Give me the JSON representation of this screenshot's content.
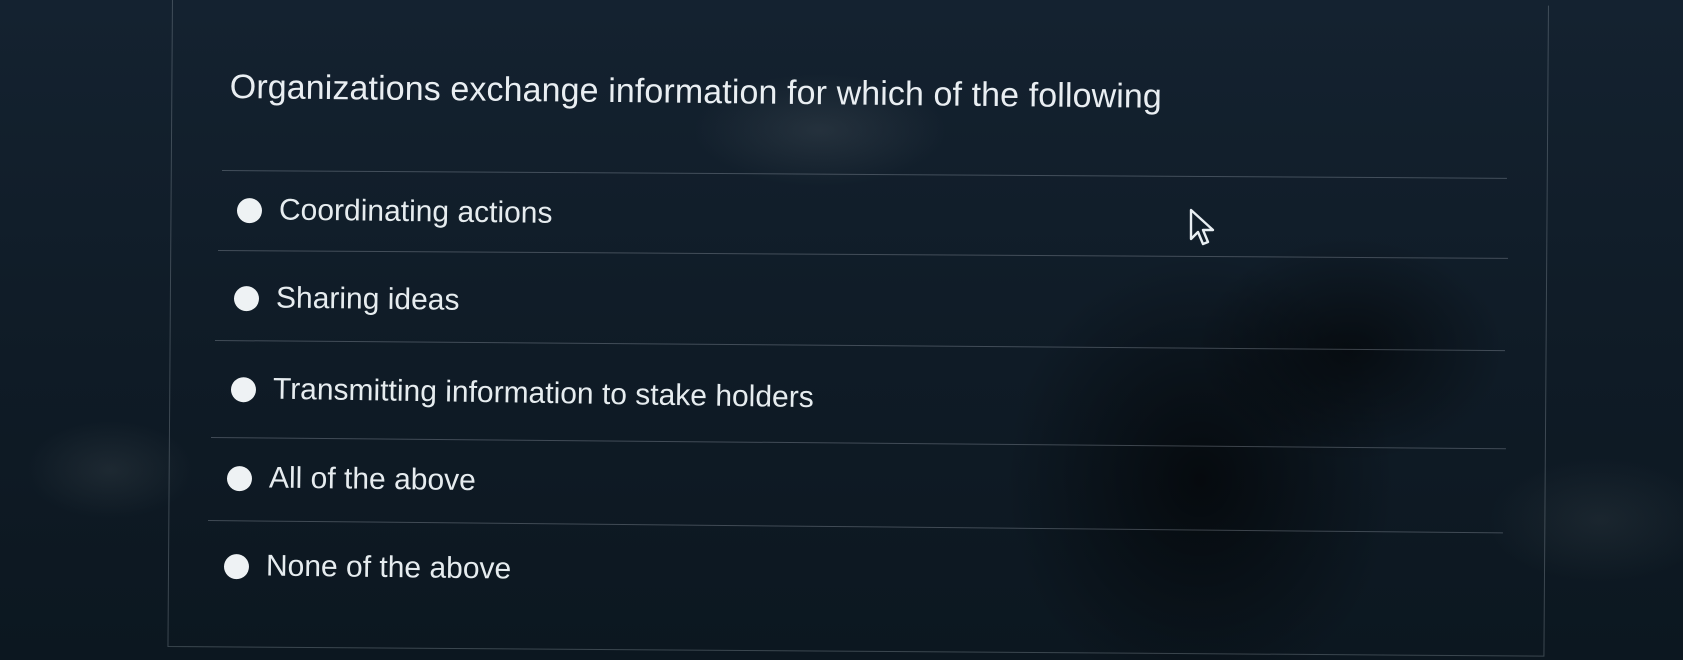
{
  "question": {
    "text": "Organizations exchange information for which of the following"
  },
  "options": [
    {
      "label": "Coordinating actions",
      "selected": false
    },
    {
      "label": "Sharing ideas",
      "selected": false
    },
    {
      "label": "Transmitting information to stake holders",
      "selected": false
    },
    {
      "label": "All of the above",
      "selected": false
    },
    {
      "label": "None of the above",
      "selected": false
    }
  ],
  "icons": {
    "radio": "radio-button-icon",
    "cursor": "mouse-pointer-icon"
  },
  "colors": {
    "background": "#0f1b26",
    "text": "#e9eef2",
    "radio": "#eef2f4"
  }
}
